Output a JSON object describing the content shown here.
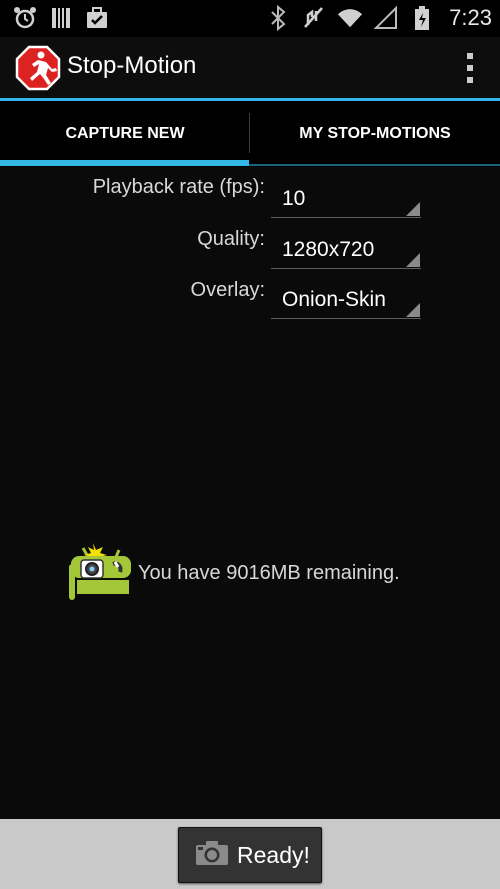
{
  "status_bar": {
    "time": "7:23",
    "left_icons": [
      "alarm-icon",
      "storage-icon",
      "briefcase-check-icon"
    ],
    "right_icons": [
      "bluetooth-icon",
      "mute-icon",
      "wifi-icon",
      "signal-icon",
      "battery-icon"
    ]
  },
  "app": {
    "title": "Stop-Motion",
    "logo_icon": "running-man-stop-sign-icon",
    "accent_color": "#33b5e5"
  },
  "tabs": [
    {
      "label": "CAPTURE NEW",
      "active": true
    },
    {
      "label": "MY STOP-MOTIONS",
      "active": false
    }
  ],
  "settings": {
    "playback": {
      "label": "Playback rate (fps):",
      "value": "10"
    },
    "quality": {
      "label": "Quality:",
      "value": "1280x720"
    },
    "overlay": {
      "label": "Overlay:",
      "value": "Onion-Skin"
    }
  },
  "storage": {
    "message": "You have 9016MB remaining.",
    "icon": "android-camera-icon"
  },
  "bottom": {
    "ready_label": "Ready!",
    "camera_icon": "camera-icon"
  }
}
